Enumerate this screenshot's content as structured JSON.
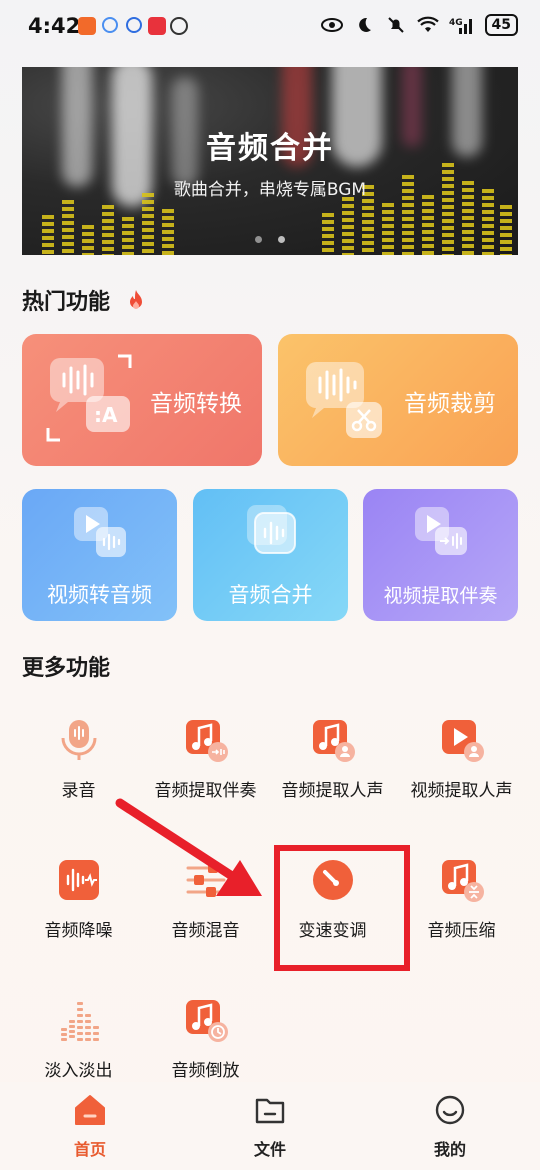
{
  "status_bar": {
    "time": "4:42",
    "battery": "45",
    "network": "4G"
  },
  "banner": {
    "title": "音频合并",
    "subtitle": "歌曲合并，串烧专属BGM"
  },
  "hot_section": {
    "title": "热门功能"
  },
  "hot_cards": {
    "convert": "音频转换",
    "cut": "音频裁剪",
    "video_to_audio": "视频转音频",
    "merge": "音频合并",
    "extract_accomp": "视频提取伴奏"
  },
  "more_section": {
    "title": "更多功能"
  },
  "more_items": [
    {
      "label": "录音",
      "icon": "microphone-icon"
    },
    {
      "label": "音频提取伴奏",
      "icon": "music-accompaniment-icon"
    },
    {
      "label": "音频提取人声",
      "icon": "music-vocal-icon"
    },
    {
      "label": "视频提取人声",
      "icon": "video-vocal-icon"
    },
    {
      "label": "音频降噪",
      "icon": "noise-reduction-icon"
    },
    {
      "label": "音频混音",
      "icon": "mixer-icon"
    },
    {
      "label": "变速变调",
      "icon": "speedometer-icon"
    },
    {
      "label": "音频压缩",
      "icon": "compress-icon"
    },
    {
      "label": "淡入淡出",
      "icon": "fade-icon"
    },
    {
      "label": "音频倒放",
      "icon": "reverse-icon"
    }
  ],
  "bottom_nav": [
    {
      "label": "首页",
      "icon": "home-icon",
      "active": true
    },
    {
      "label": "文件",
      "icon": "folder-icon",
      "active": false
    },
    {
      "label": "我的",
      "icon": "smile-icon",
      "active": false
    }
  ],
  "colors": {
    "accent": "#f0603a",
    "highlight": "#e8202a",
    "nav_active": "#e85a2e"
  }
}
